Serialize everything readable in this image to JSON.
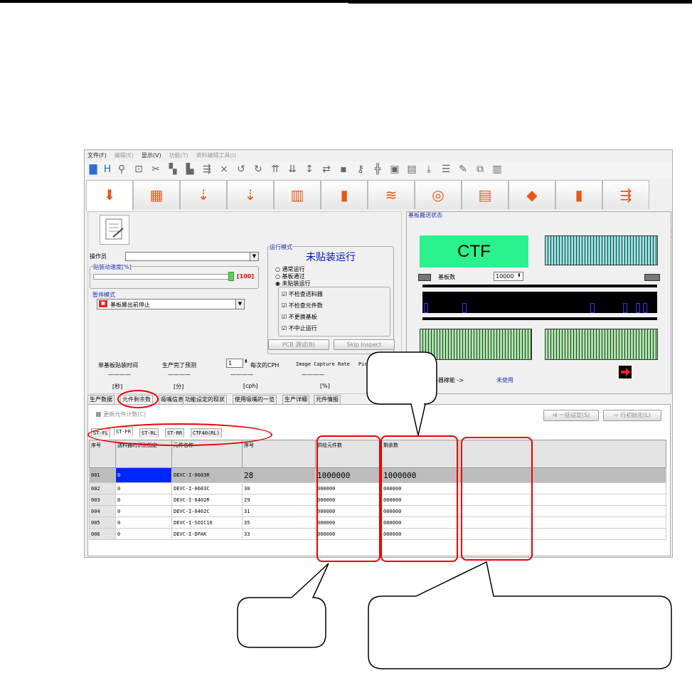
{
  "menu": [
    "文件(F)",
    "编辑(E)",
    "显示(V)",
    "功能(T)",
    "资料编辑工具(I)"
  ],
  "operator": {
    "label": "操作员",
    "value": ""
  },
  "speed": {
    "label": "贴装动速度[%]",
    "value": "[100]",
    "level_percent": 100
  },
  "stop_mode": {
    "label": "暂停模式",
    "value": "基板搬出前停止"
  },
  "run_mode": {
    "label": "运行模式",
    "title": "未贴装运行",
    "options": [
      "通常运行",
      "基板通过",
      "未贴装运行"
    ],
    "selected": "未贴装运行",
    "checks": [
      "不检查送料器",
      "不检查元件数",
      "不更换基板",
      "不中止运行"
    ],
    "buttons": [
      "PCB 测试(B)",
      "Skip Inspect"
    ]
  },
  "transfer": {
    "label": "基板搬送状态",
    "ctf": "CTF",
    "board_count_label": "基板数",
    "board_count": "10000",
    "info_label": "料器稼能 ->",
    "info_value": "未使用"
  },
  "stats": {
    "headers": [
      "单基板贴装时间",
      "生产完了预测",
      "每次的CPH",
      "Image Capture Rate",
      "Pick"
    ],
    "count": "1",
    "values": [
      "————",
      "————",
      "————",
      "————"
    ],
    "units": [
      "[秒]",
      "[分]",
      "[cph]",
      "[%]"
    ]
  },
  "sub_tabs": [
    "生产数据",
    "元件剩余数",
    "吸嘴信息",
    "功能设定的现状",
    "使用吸嘴的一览",
    "生产详细",
    "元件情报"
  ],
  "lower": {
    "update_button": "更新元件计数(C)",
    "btn_bulk": "一括设定(S)",
    "btn_init": "行初始化(L)",
    "station_tabs": [
      "ST-FL",
      "ST-FR",
      "ST-RL",
      "ST-RR",
      "CTF40(RL)"
    ],
    "columns": [
      "序号",
      "送料器的识别指定",
      "元件名称",
      "序号",
      "供给元件数",
      "剩余数"
    ],
    "rows": [
      [
        "001",
        "0",
        "DEVC-I-0603R",
        "28",
        "1000000",
        "1000000"
      ],
      [
        "002",
        "0",
        "DEVC-I-0603C",
        "30",
        "000000",
        "000000"
      ],
      [
        "003",
        "0",
        "DEVC-I-0402R",
        "29",
        "000000",
        "000000"
      ],
      [
        "004",
        "0",
        "DEVC-I-0402C",
        "31",
        "000000",
        "000000"
      ],
      [
        "005",
        "0",
        "DEVC-I-SOIC16",
        "35",
        "000000",
        "000000"
      ],
      [
        "006",
        "0",
        "DEVC-I-DPAK",
        "33",
        "000000",
        "000000"
      ]
    ]
  },
  "colors": {
    "annotation_red": "#ee0000",
    "ctf_green": "#2af28c",
    "accent_orange": "#e8581a",
    "selection_blue": "#0026ff"
  }
}
